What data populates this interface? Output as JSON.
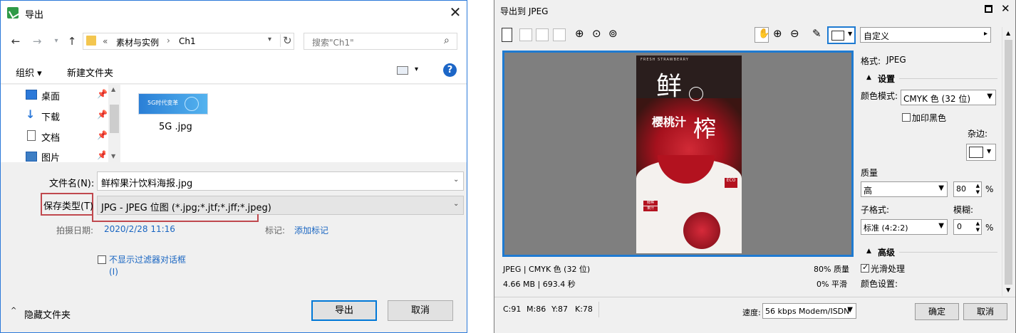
{
  "export_dialog": {
    "title": "导出",
    "breadcrumb": {
      "prefix": "«",
      "parts": [
        "素材与实例",
        "Ch1"
      ]
    },
    "search_placeholder": "搜索\"Ch1\"",
    "toolbar": {
      "organize": "组织 ▾",
      "new_folder": "新建文件夹"
    },
    "sidebar": {
      "items": [
        {
          "label": "桌面",
          "icon": "desktop-icon"
        },
        {
          "label": "下载",
          "icon": "download-icon"
        },
        {
          "label": "文档",
          "icon": "document-icon"
        },
        {
          "label": "图片",
          "icon": "picture-icon"
        }
      ]
    },
    "files": [
      {
        "name": "5G .jpg",
        "thumb_text": "5G时代变革"
      }
    ],
    "filename_label": "文件名(N):",
    "filename_value": "鲜榨果汁饮料海报.jpg",
    "savetype_label": "保存类型(T)",
    "savetype_value": "JPG - JPEG 位图 (*.jpg;*.jtf;*.jff;*.jpeg)",
    "date_label": "拍摄日期:",
    "date_value": "2020/2/28 11:16",
    "tag_label": "标记:",
    "tag_value": "添加标记",
    "no_filter_label": "不显示过滤器对话框",
    "no_filter_label2": "(I)",
    "hide_folders": "隐藏文件夹",
    "export_button": "导出",
    "cancel_button": "取消"
  },
  "jpeg_dialog": {
    "title": "导出到 JPEG",
    "preset_value": "自定义",
    "format_label": "格式:",
    "format_value": "JPEG",
    "settings_header": "设置",
    "color_mode_label": "颜色模式:",
    "color_mode_value": "CMYK 色 (32 位)",
    "overprint_black": "加印黑色",
    "matte_label": "杂边:",
    "quality_label": "质量",
    "quality_value": "高",
    "quality_number": "80",
    "percent": "%",
    "subformat_label": "子格式:",
    "subformat_value": "标准 (4:2:2)",
    "blur_label": "模糊:",
    "blur_value": "0",
    "advanced_header": "高级",
    "smoothing": "光滑处理",
    "color_settings": "颜色设置:",
    "status_format": "JPEG | CMYK 色 (32 位)",
    "status_quality": "80% 质量",
    "status_size": "4.66 MB | 693.4 秒",
    "status_smooth": "0% 平滑",
    "cmyk": {
      "c": "C:91",
      "m": "M:86",
      "y": "Y:87",
      "k": "K:78"
    },
    "speed_label": "速度:",
    "speed_value": "56 kbps Modem/ISDN",
    "ok_button": "确定",
    "cancel_button": "取消",
    "poster": {
      "top_line": "FRESH STRAWBERRY",
      "big1": "鲜",
      "big2": "榨",
      "sub": "樱桃汁",
      "eco": "ECO",
      "side1": "鲜榨",
      "side2": "果汁"
    }
  },
  "colors": {
    "accent": "#1e7ad1",
    "highlight": "#c0484e",
    "folder": "#f3c64f",
    "cherry": "#b3121f"
  }
}
